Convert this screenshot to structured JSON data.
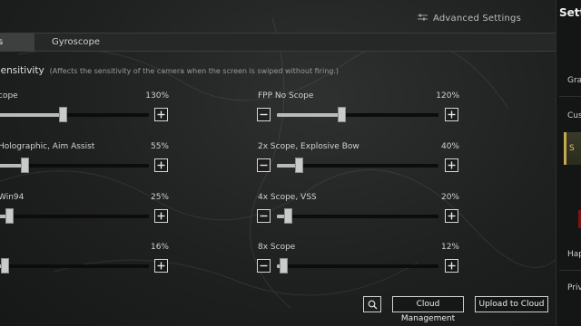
{
  "header": {
    "advanced_settings_label": "Advanced Settings",
    "advanced_icon": "sliders-icon"
  },
  "tabs": [
    {
      "label": "s",
      "active": true
    },
    {
      "label": "Gyroscope",
      "active": false
    }
  ],
  "section": {
    "title": "Sensitivity",
    "note": "(Affects the sensitivity of the camera when the screen is swiped without firing.)"
  },
  "sliders_left": [
    {
      "label": "cope",
      "value_text": "130%",
      "value": 130
    },
    {
      "label": "Holographic, Aim Assist",
      "value_text": "55%",
      "value": 55
    },
    {
      "label": "Win94",
      "value_text": "25%",
      "value": 25
    },
    {
      "label": "",
      "value_text": "16%",
      "value": 16
    }
  ],
  "sliders_right": [
    {
      "label": "FPP No Scope",
      "value_text": "120%",
      "value": 120
    },
    {
      "label": "2x Scope, Explosive Bow",
      "value_text": "40%",
      "value": 40
    },
    {
      "label": "4x Scope, VSS",
      "value_text": "20%",
      "value": 20
    },
    {
      "label": "8x Scope",
      "value_text": "12%",
      "value": 12
    }
  ],
  "slider_range": {
    "min": 0,
    "max": 300
  },
  "footer": {
    "search_icon": "search-icon",
    "cloud_management_label": "Cloud Management",
    "upload_label": "Upload to Cloud"
  },
  "right_panel": {
    "title": "Setti",
    "items": [
      "Gra",
      "Cust",
      "S",
      "Hap",
      "Priv"
    ],
    "active_index": 2,
    "accent_color": "#c6a94a"
  }
}
